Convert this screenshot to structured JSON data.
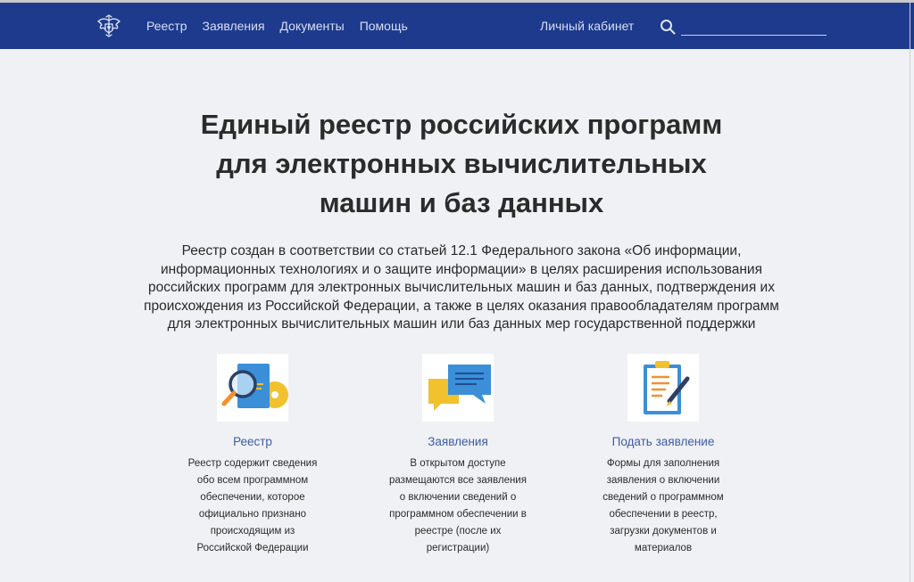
{
  "header": {
    "nav": [
      {
        "label": "Реестр"
      },
      {
        "label": "Заявления"
      },
      {
        "label": "Документы"
      },
      {
        "label": "Помощь"
      }
    ],
    "cabinet_label": "Личный кабинет",
    "search": {
      "value": "",
      "placeholder": ""
    }
  },
  "hero": {
    "title_lines": [
      "Единый реестр российских программ",
      "для электронных вычислительных",
      "машин и баз данных"
    ],
    "lead_lines": [
      "Реестр создан в соответствии со статьей 12.1 Федерального закона «Об информации,",
      "информационных технологиях и о защите информации» в целях расширения использования",
      "российских программ для электронных вычислительных машин и баз данных, подтверждения их",
      "происхождения из Российской Федерации, а также в целях оказания правообладателям программ",
      "для электронных вычислительных машин или баз данных мер государственной поддержки"
    ]
  },
  "cards": [
    {
      "title": "Реестр",
      "icon": "registry-search-icon",
      "desc_lines": [
        "Реестр содержит сведения",
        "обо всем программном",
        "обеспечении, которое",
        "официально признано",
        "происходящим из",
        "Российской Федерации"
      ]
    },
    {
      "title": "Заявления",
      "icon": "chat-bubbles-icon",
      "desc_lines": [
        "В открытом доступе",
        "размещаются все заявления",
        "о включении сведений о",
        "программном обеспечении в",
        "реестре (после их",
        "регистрации)"
      ]
    },
    {
      "title": "Подать заявление",
      "icon": "clipboard-pen-icon",
      "desc_lines": [
        "Формы для заполнения",
        "заявления о включении",
        "сведений о программном",
        "обеспечении в реестр,",
        "загрузки документов и",
        "материалов"
      ]
    }
  ],
  "colors": {
    "header_bg": "#1e3a8c",
    "link": "#3b5ba8",
    "accent_yellow": "#f2c12e",
    "accent_blue": "#3a8fd8"
  }
}
